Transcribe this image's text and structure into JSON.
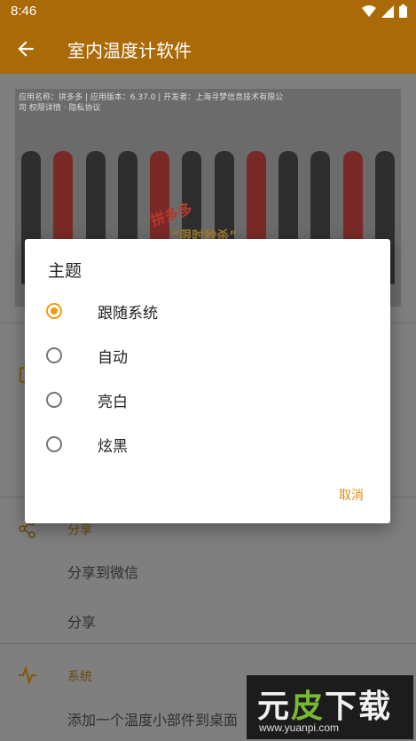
{
  "status_bar": {
    "time": "8:46",
    "icons": [
      "wifi-icon",
      "signal-icon",
      "battery-icon"
    ]
  },
  "app_bar": {
    "title": "室内温度计软件",
    "back_icon": "arrow-back-icon"
  },
  "ad": {
    "info_text": "应用名称：拼多多 | 应用版本：6.37.0 | 开发者：上海寻梦信息技术有限公司 权限详情 · 隐私协议",
    "brand": "拼多多",
    "slogan": "“限时秒杀”"
  },
  "sections": {
    "share_label": "分享",
    "share_wechat": "分享到微信",
    "share": "分享",
    "system_label": "系统",
    "add_widget": "添加一个温度小部件到桌面"
  },
  "dialog": {
    "title": "主题",
    "options": [
      {
        "label": "跟随系统",
        "selected": true
      },
      {
        "label": "自动",
        "selected": false
      },
      {
        "label": "亮白",
        "selected": false
      },
      {
        "label": "炫黑",
        "selected": false
      }
    ],
    "cancel": "取消"
  },
  "watermark": {
    "title_main": "元",
    "title_accent": "皮",
    "title_rest": "下载",
    "url": "www.yuanpi.com"
  },
  "colors": {
    "primary": "#ab6a08",
    "accent": "#f39c12"
  }
}
